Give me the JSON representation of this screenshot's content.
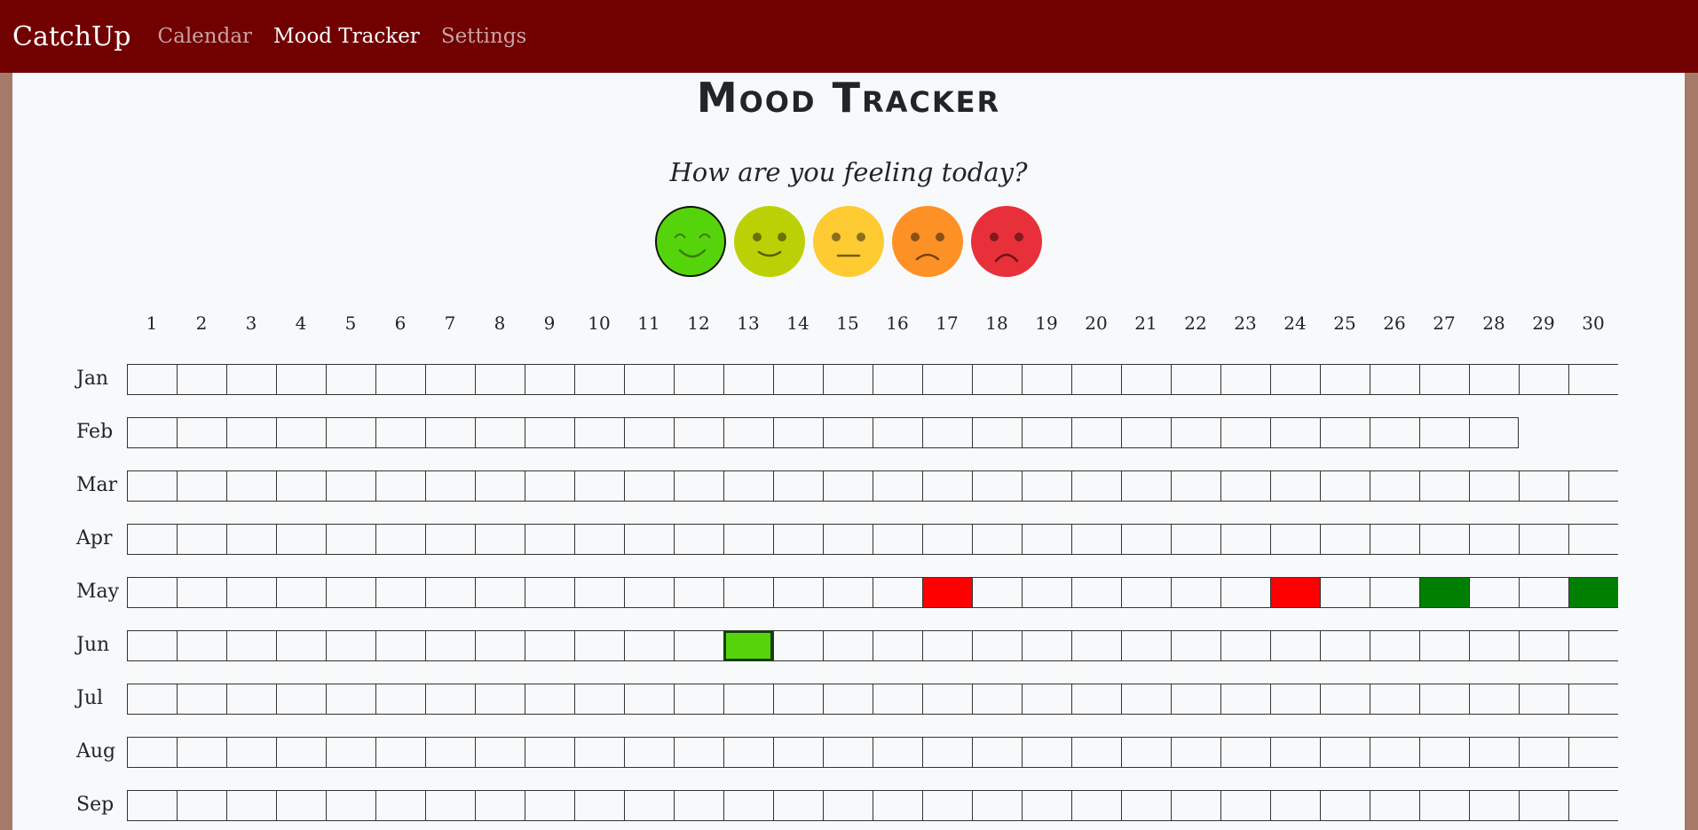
{
  "navbar": {
    "brand": "CatchUp",
    "links": [
      {
        "label": "Calendar",
        "active": false
      },
      {
        "label": "Mood Tracker",
        "active": true
      },
      {
        "label": "Settings",
        "active": false
      }
    ],
    "colors": {
      "background": "#710000",
      "active": "#ffffff",
      "inactive": "#c9a3a3"
    }
  },
  "page": {
    "title": "Mood Tracker",
    "question": "How are you feeling today?"
  },
  "moods": [
    {
      "name": "very-happy",
      "icon": "very-happy-face-icon",
      "color": "#55d40b",
      "selected": true
    },
    {
      "name": "happy",
      "icon": "happy-face-icon",
      "color": "#bcd105",
      "selected": false
    },
    {
      "name": "neutral",
      "icon": "neutral-face-icon",
      "color": "#fecb33",
      "selected": false
    },
    {
      "name": "sad",
      "icon": "sad-face-icon",
      "color": "#fe9125",
      "selected": false
    },
    {
      "name": "very-sad",
      "icon": "very-sad-face-icon",
      "color": "#e8303a",
      "selected": false
    }
  ],
  "tracker": {
    "days": [
      "1",
      "2",
      "3",
      "4",
      "5",
      "6",
      "7",
      "8",
      "9",
      "10",
      "11",
      "12",
      "13",
      "14",
      "15",
      "16",
      "17",
      "18",
      "19",
      "20",
      "21",
      "22",
      "23",
      "24",
      "25",
      "26",
      "27",
      "28",
      "29",
      "30"
    ],
    "months": [
      {
        "label": "Jan",
        "days": 30
      },
      {
        "label": "Feb",
        "days": 28
      },
      {
        "label": "Mar",
        "days": 30
      },
      {
        "label": "Apr",
        "days": 30
      },
      {
        "label": "May",
        "days": 30
      },
      {
        "label": "Jun",
        "days": 30
      },
      {
        "label": "Jul",
        "days": 30
      },
      {
        "label": "Aug",
        "days": 30
      },
      {
        "label": "Sep",
        "days": 30
      }
    ],
    "entries": [
      {
        "month": "May",
        "day": 17,
        "color": "#ff0000"
      },
      {
        "month": "May",
        "day": 24,
        "color": "#ff0000"
      },
      {
        "month": "May",
        "day": 27,
        "color": "#008000"
      },
      {
        "month": "May",
        "day": 30,
        "color": "#008000"
      },
      {
        "month": "Jun",
        "day": 13,
        "color": "#55d40b",
        "today": true
      }
    ]
  }
}
